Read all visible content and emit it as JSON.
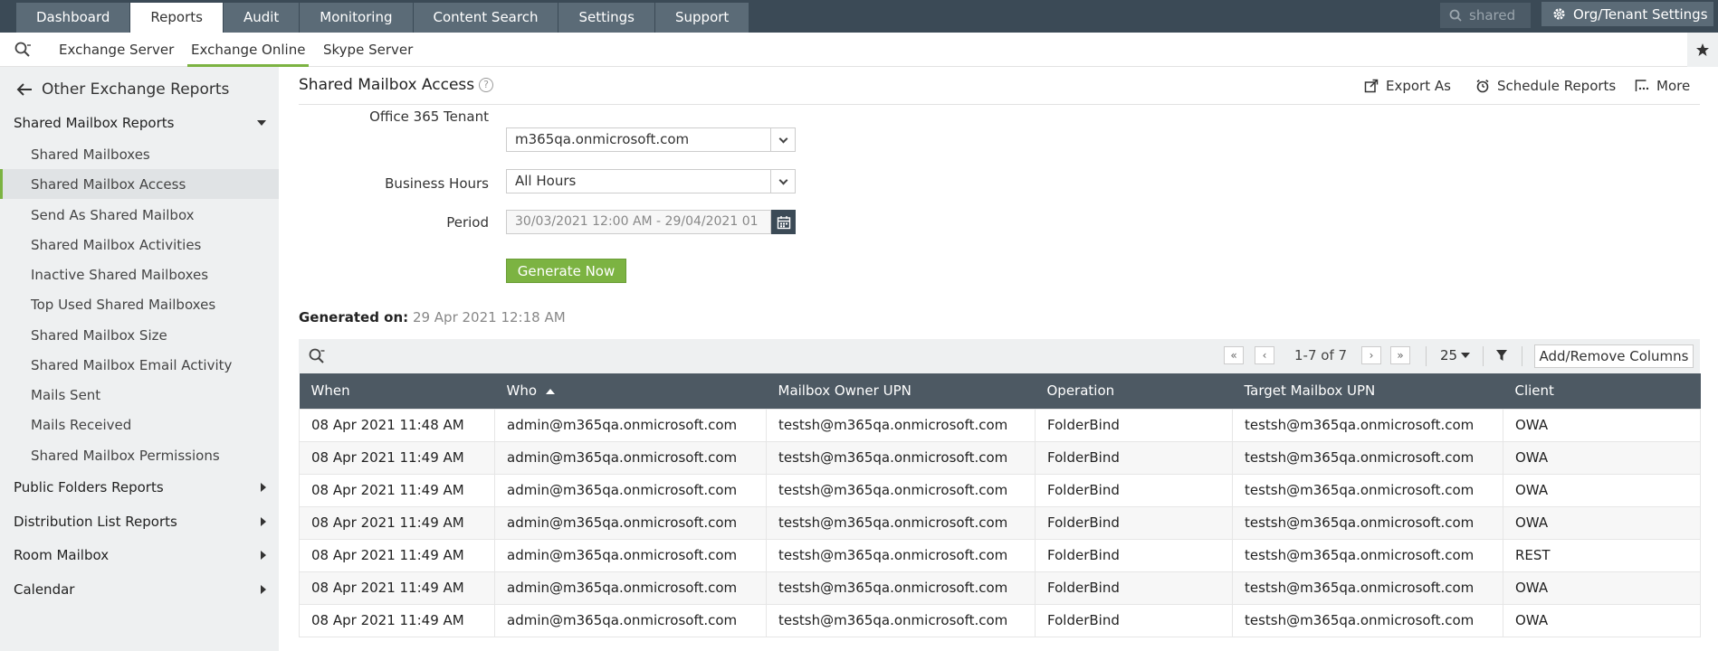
{
  "topnav": {
    "tabs": [
      "Dashboard",
      "Reports",
      "Audit",
      "Monitoring",
      "Content Search",
      "Settings",
      "Support"
    ],
    "active": "Reports",
    "search_text": "shared",
    "org_button": "Org/Tenant Settings"
  },
  "subnav": {
    "tabs": [
      "Exchange Server",
      "Exchange Online",
      "Skype Server"
    ],
    "active": "Exchange Online"
  },
  "sidebar": {
    "back_label": "Other Exchange Reports",
    "section_open": "Shared Mailbox Reports",
    "items": [
      "Shared Mailboxes",
      "Shared Mailbox Access",
      "Send As Shared Mailbox",
      "Shared Mailbox Activities",
      "Inactive Shared Mailboxes",
      "Top Used Shared Mailboxes",
      "Shared Mailbox Size",
      "Shared Mailbox Email Activity",
      "Mails Sent",
      "Mails Received",
      "Shared Mailbox Permissions"
    ],
    "active_item": "Shared Mailbox Access",
    "sections_collapsed": [
      "Public Folders Reports",
      "Distribution List Reports",
      "Room Mailbox",
      "Calendar"
    ]
  },
  "page": {
    "title": "Shared Mailbox Access",
    "help": "?",
    "actions": {
      "export": "Export As",
      "schedule": "Schedule Reports",
      "more": "More"
    }
  },
  "form": {
    "tenant_label": "Office 365 Tenant",
    "tenant_value": "m365qa.onmicrosoft.com",
    "hours_label": "Business Hours",
    "hours_value": "All Hours",
    "period_label": "Period",
    "period_value": "30/03/2021 12:00 AM - 29/04/2021 01",
    "generate_button": "Generate Now"
  },
  "generated": {
    "label": "Generated on:",
    "value": "29 Apr 2021 12:18 AM"
  },
  "grid": {
    "pager_info": "1-7 of 7",
    "per_page": "25",
    "add_columns": "Add/Remove Columns",
    "columns": [
      "When",
      "Who",
      "Mailbox Owner UPN",
      "Operation",
      "Target Mailbox UPN",
      "Client"
    ],
    "sorted_column": "Who",
    "rows": [
      [
        "08 Apr 2021 11:48 AM",
        "admin@m365qa.onmicrosoft.com",
        "testsh@m365qa.onmicrosoft.com",
        "FolderBind",
        "testsh@m365qa.onmicrosoft.com",
        "OWA"
      ],
      [
        "08 Apr 2021 11:49 AM",
        "admin@m365qa.onmicrosoft.com",
        "testsh@m365qa.onmicrosoft.com",
        "FolderBind",
        "testsh@m365qa.onmicrosoft.com",
        "OWA"
      ],
      [
        "08 Apr 2021 11:49 AM",
        "admin@m365qa.onmicrosoft.com",
        "testsh@m365qa.onmicrosoft.com",
        "FolderBind",
        "testsh@m365qa.onmicrosoft.com",
        "OWA"
      ],
      [
        "08 Apr 2021 11:49 AM",
        "admin@m365qa.onmicrosoft.com",
        "testsh@m365qa.onmicrosoft.com",
        "FolderBind",
        "testsh@m365qa.onmicrosoft.com",
        "OWA"
      ],
      [
        "08 Apr 2021 11:49 AM",
        "admin@m365qa.onmicrosoft.com",
        "testsh@m365qa.onmicrosoft.com",
        "FolderBind",
        "testsh@m365qa.onmicrosoft.com",
        "REST"
      ],
      [
        "08 Apr 2021 11:49 AM",
        "admin@m365qa.onmicrosoft.com",
        "testsh@m365qa.onmicrosoft.com",
        "FolderBind",
        "testsh@m365qa.onmicrosoft.com",
        "OWA"
      ],
      [
        "08 Apr 2021 11:49 AM",
        "admin@m365qa.onmicrosoft.com",
        "testsh@m365qa.onmicrosoft.com",
        "FolderBind",
        "testsh@m365qa.onmicrosoft.com",
        "OWA"
      ]
    ]
  },
  "colors": {
    "accent": "#7cb342",
    "topbar": "#3b4a56",
    "table_header": "#4d5963"
  }
}
